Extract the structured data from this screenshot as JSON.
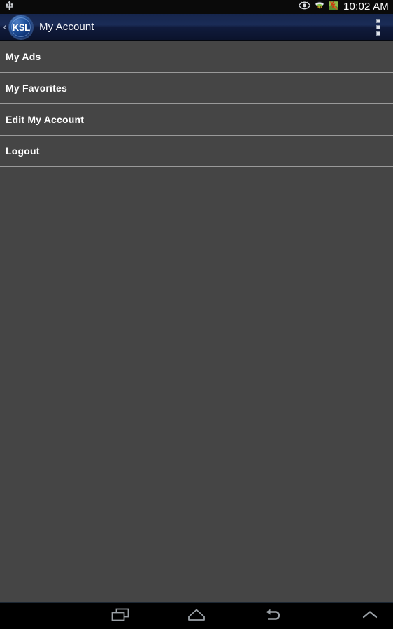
{
  "status_bar": {
    "usb_icon": "usb-icon",
    "eye_icon": "eye-icon",
    "wifi_icon": "wifi-icon",
    "app_icon": "notification-app-icon",
    "time": "10:02 AM"
  },
  "action_bar": {
    "back_chevron": "‹",
    "logo_text": "KSL",
    "title": "My Account",
    "overflow_label": "More options"
  },
  "list": {
    "items": [
      {
        "label": "My Ads"
      },
      {
        "label": "My Favorites"
      },
      {
        "label": "Edit My Account"
      },
      {
        "label": "Logout"
      }
    ]
  },
  "nav_bar": {
    "recents_label": "Recent apps",
    "home_label": "Home",
    "back_label": "Back",
    "expand_label": "Expand"
  },
  "colors": {
    "list_background": "#454545",
    "list_divider": "#9a9a9a",
    "action_bar_top": "#1a2c57",
    "action_bar_bottom": "#0b132c",
    "status_bar": "#0a0a0a",
    "nav_bar": "#000000",
    "text_primary": "#ffffff",
    "ksl_blue": "#1d4f9b"
  }
}
